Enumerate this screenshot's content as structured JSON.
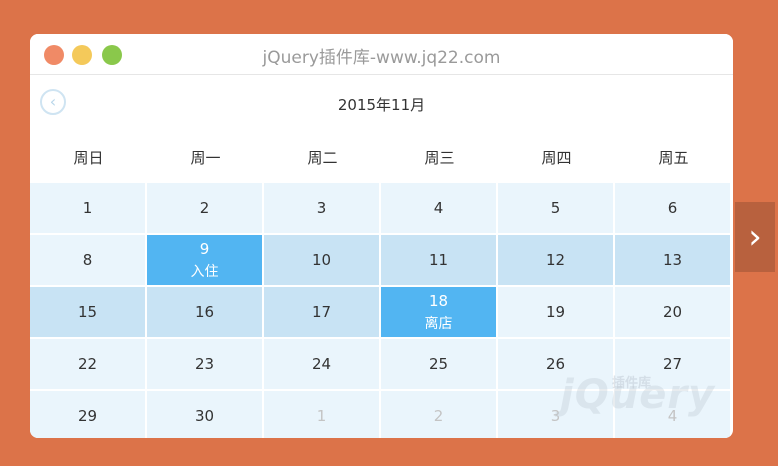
{
  "window": {
    "title": "jQuery插件库-www.jq22.com"
  },
  "calendar": {
    "month_label": "2015年11月",
    "prev_icon": "chevron-left-icon",
    "weekdays": [
      "周日",
      "周一",
      "周二",
      "周三",
      "周四",
      "周五"
    ],
    "rows": [
      [
        {
          "day": "1",
          "style": "light"
        },
        {
          "day": "2",
          "style": "light"
        },
        {
          "day": "3",
          "style": "light"
        },
        {
          "day": "4",
          "style": "light"
        },
        {
          "day": "5",
          "style": "light"
        },
        {
          "day": "6",
          "style": "light"
        }
      ],
      [
        {
          "day": "8",
          "style": "light"
        },
        {
          "day": "9",
          "style": "sel",
          "tag": "入住"
        },
        {
          "day": "10",
          "style": "mid"
        },
        {
          "day": "11",
          "style": "mid"
        },
        {
          "day": "12",
          "style": "mid"
        },
        {
          "day": "13",
          "style": "mid"
        }
      ],
      [
        {
          "day": "15",
          "style": "mid"
        },
        {
          "day": "16",
          "style": "mid"
        },
        {
          "day": "17",
          "style": "mid"
        },
        {
          "day": "18",
          "style": "sel",
          "tag": "离店"
        },
        {
          "day": "19",
          "style": "light"
        },
        {
          "day": "20",
          "style": "light"
        }
      ],
      [
        {
          "day": "22",
          "style": "light"
        },
        {
          "day": "23",
          "style": "light"
        },
        {
          "day": "24",
          "style": "light"
        },
        {
          "day": "25",
          "style": "light"
        },
        {
          "day": "26",
          "style": "light"
        },
        {
          "day": "27",
          "style": "light"
        }
      ],
      [
        {
          "day": "29",
          "style": "light"
        },
        {
          "day": "30",
          "style": "light"
        },
        {
          "day": "1",
          "style": "other"
        },
        {
          "day": "2",
          "style": "other"
        },
        {
          "day": "3",
          "style": "other"
        },
        {
          "day": "4",
          "style": "other"
        }
      ]
    ]
  },
  "next_icon": "chevron-right-icon",
  "watermark": {
    "text": "jQuery",
    "sub": "插件库"
  },
  "colors": {
    "background": "#dc7349",
    "selected": "#52b5f2",
    "range": "#c8e3f4",
    "cell": "#eaf5fc"
  }
}
